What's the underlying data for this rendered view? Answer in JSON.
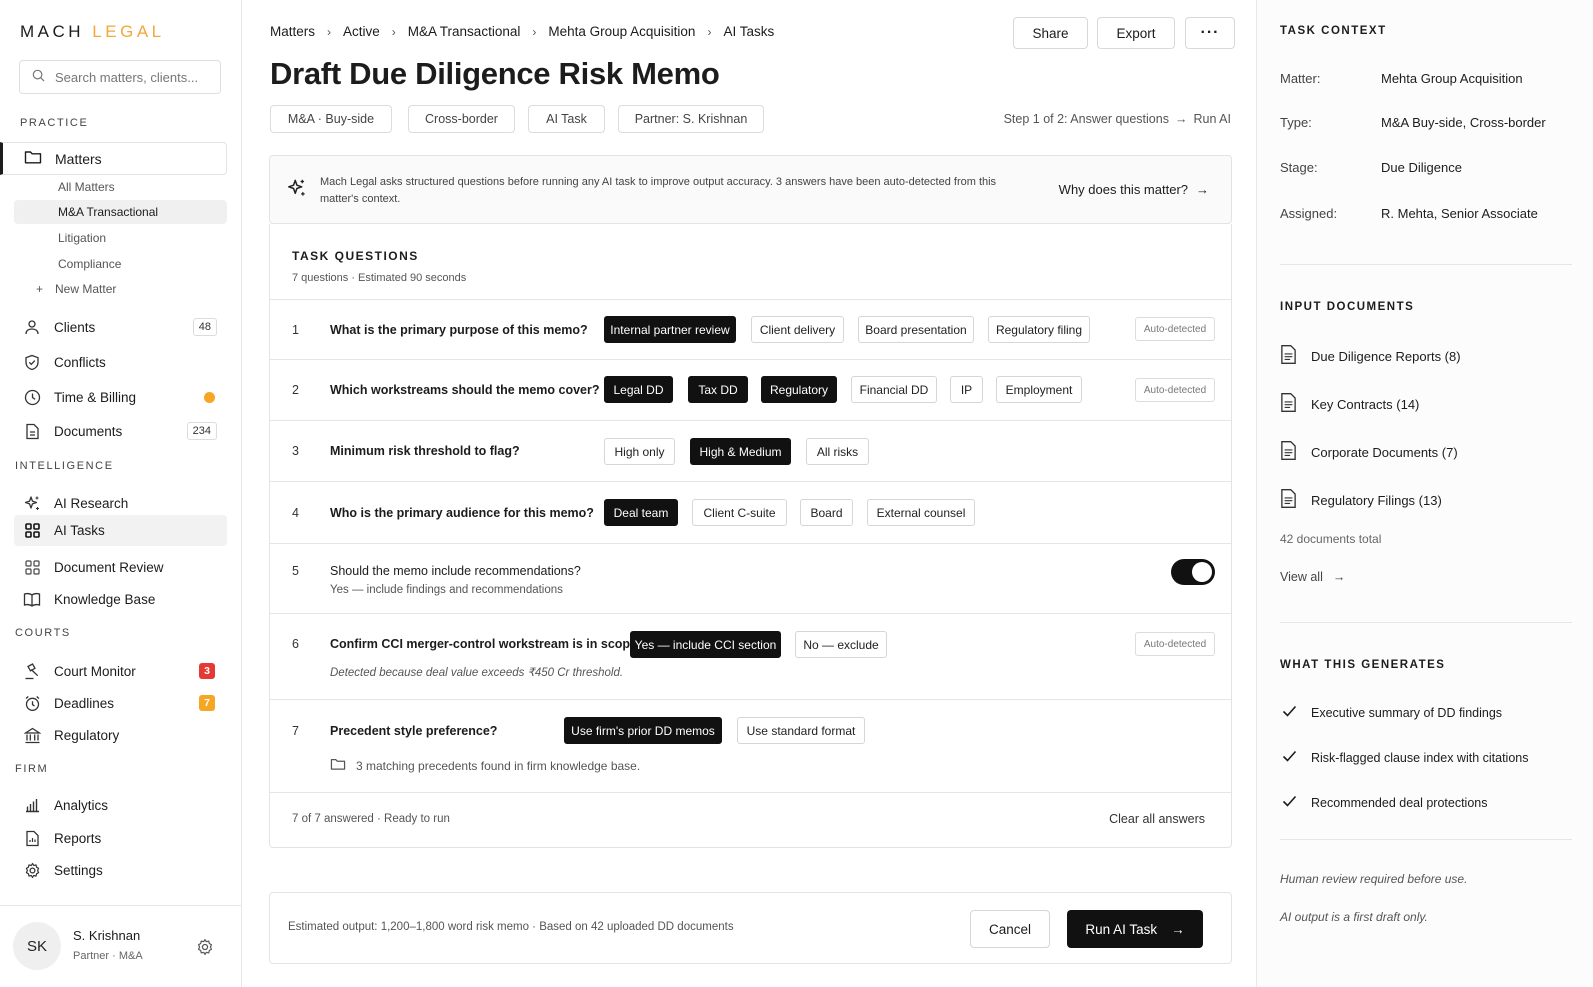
{
  "brand": {
    "part1": "MACH",
    "part2": "LEGAL"
  },
  "search": {
    "placeholder": "Search matters, clients..."
  },
  "sidebar": {
    "practice_label": "PRACTICE",
    "matters": "Matters",
    "matter_subs": [
      "All Matters",
      "M&A Transactional",
      "Litigation",
      "Compliance"
    ],
    "new_matter": "New Matter",
    "clients": "Clients",
    "clients_count": "48",
    "conflicts": "Conflicts",
    "time_billing": "Time & Billing",
    "documents": "Documents",
    "documents_count": "234",
    "intelligence_label": "INTELLIGENCE",
    "ai_research": "AI Research",
    "ai_tasks": "AI Tasks",
    "document_review": "Document Review",
    "knowledge_base": "Knowledge Base",
    "courts_label": "COURTS",
    "court_monitor": "Court Monitor",
    "court_monitor_count": "3",
    "deadlines": "Deadlines",
    "deadlines_count": "7",
    "regulatory": "Regulatory",
    "firm_label": "FIRM",
    "analytics": "Analytics",
    "reports": "Reports",
    "settings": "Settings"
  },
  "user": {
    "initials": "SK",
    "name": "S. Krishnan",
    "role": "Partner · M&A"
  },
  "breadcrumb": [
    "Matters",
    "Active",
    "M&A Transactional",
    "Mehta Group Acquisition",
    "AI Tasks"
  ],
  "actions": {
    "share": "Share",
    "export": "Export",
    "more": "···"
  },
  "title": "Draft Due Diligence Risk Memo",
  "tags": [
    "M&A · Buy-side",
    "Cross-border",
    "AI Task",
    "Partner: S. Krishnan"
  ],
  "step": {
    "text": "Step 1 of 2: Answer questions",
    "next": "Run AI"
  },
  "info": {
    "text": "Mach Legal asks structured questions before running any AI task to improve output accuracy. 3 answers have been auto-detected from this matter's context.",
    "link": "Why does this matter?"
  },
  "questions_header": {
    "title": "TASK QUESTIONS",
    "subtitle": "7 questions · Estimated 90 seconds"
  },
  "auto_label": "Auto-detected",
  "questions": [
    {
      "num": "1",
      "text": "What is the primary purpose of this memo?",
      "options": [
        "Internal partner review",
        "Client delivery",
        "Board presentation",
        "Regulatory filing"
      ]
    },
    {
      "num": "2",
      "text": "Which workstreams should the memo cover?",
      "options": [
        "Legal DD",
        "Tax DD",
        "Regulatory",
        "Financial DD",
        "IP",
        "Employment"
      ]
    },
    {
      "num": "3",
      "text": "Minimum risk threshold to flag?",
      "options": [
        "High only",
        "High & Medium",
        "All risks"
      ]
    },
    {
      "num": "4",
      "text": "Who is the primary audience for this memo?",
      "options": [
        "Deal team",
        "Client C-suite",
        "Board",
        "External counsel"
      ]
    },
    {
      "num": "5",
      "text": "Should the memo include recommendations?",
      "hint": "Yes — include findings and recommendations",
      "toggle": true
    },
    {
      "num": "6",
      "text": "Confirm CCI merger-control workstream is in scope?",
      "options": [
        "Yes — include CCI section",
        "No — exclude"
      ],
      "hint": "Detected because deal value exceeds ₹450 Cr threshold."
    },
    {
      "num": "7",
      "text": "Precedent style preference?",
      "options": [
        "Use firm's prior DD memos",
        "Use standard format"
      ],
      "hint": "3 matching precedents found in firm knowledge base."
    }
  ],
  "questions_footer": {
    "status": "7 of 7 answered · Ready to run",
    "clear": "Clear all answers"
  },
  "run_bar": {
    "estimate": "Estimated output: 1,200–1,800 word risk memo · Based on 42 uploaded DD documents",
    "cancel": "Cancel",
    "run": "Run AI Task"
  },
  "context": {
    "title": "TASK CONTEXT",
    "rows": [
      {
        "k": "Matter:",
        "v": "Mehta Group Acquisition"
      },
      {
        "k": "Type:",
        "v": "M&A Buy-side, Cross-border"
      },
      {
        "k": "Stage:",
        "v": "Due Diligence"
      },
      {
        "k": "Assigned:",
        "v": "R. Mehta, Senior Associate"
      }
    ]
  },
  "documents": {
    "title": "INPUT DOCUMENTS",
    "items": [
      "Due Diligence Reports (8)",
      "Key Contracts (14)",
      "Corporate Documents (7)",
      "Regulatory Filings (13)"
    ],
    "total": "42 documents total",
    "view_all": "View all"
  },
  "generates": {
    "title": "WHAT THIS GENERATES",
    "items": [
      "Executive summary of DD findings",
      "Risk-flagged clause index with citations",
      "Recommended deal protections"
    ]
  },
  "notes": [
    "Human review required before use.",
    "AI output is a first draft only."
  ],
  "colors": {
    "accent": "#f2a83b",
    "dark": "#111111",
    "red_badge": "#e53935",
    "orange_badge": "#f5a623"
  }
}
